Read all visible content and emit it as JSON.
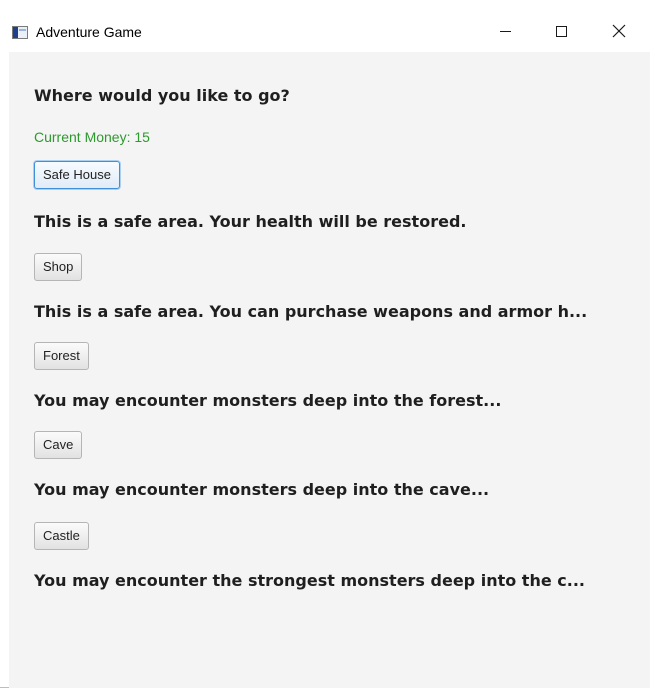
{
  "window": {
    "title": "Adventure Game",
    "icon": "java-app-icon",
    "controls": {
      "minimize": "—",
      "maximize": "☐",
      "close": "✕"
    }
  },
  "main": {
    "prompt": "Where would you like to go?",
    "money_label": "Current Money: 15",
    "money_color": "#2d9a2d",
    "locations": [
      {
        "button": "Safe House",
        "description": "This is a safe area. Your health will be restored.",
        "focused": true
      },
      {
        "button": "Shop",
        "description": "This is a safe area. You can purchase weapons and armor h..."
      },
      {
        "button": "Forest",
        "description": "You may encounter monsters deep into the forest..."
      },
      {
        "button": "Cave",
        "description": "You may encounter monsters deep into the cave..."
      },
      {
        "button": "Castle",
        "description": "You may encounter the strongest monsters deep into the c..."
      }
    ]
  }
}
